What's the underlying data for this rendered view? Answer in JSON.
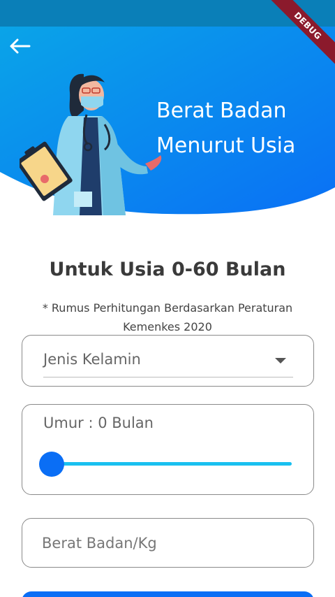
{
  "debug_badge": "DEBUG",
  "header": {
    "title_line1": "Berat Badan",
    "title_line2": "Menurut Usia",
    "back_icon": "arrow-back-icon"
  },
  "main": {
    "title": "Untuk Usia 0-60 Bulan",
    "subtitle": "* Rumus Perhitungan Berdasarkan Peraturan Kemenkes 2020"
  },
  "form": {
    "gender_dropdown": {
      "placeholder": "Jenis Kelamin",
      "icon": "dropdown-arrow-icon"
    },
    "age": {
      "label": "Umur : 0 Bulan",
      "slider_value": 0,
      "slider_min": 0,
      "slider_max": 60
    },
    "weight_input": {
      "placeholder": "Berat Badan/Kg",
      "value": ""
    }
  },
  "colors": {
    "header_gradient_start": "#0aa0e6",
    "header_gradient_end": "#0a6ef5",
    "status_bar": "#0a7fb8",
    "accent": "#0a6ef5",
    "slider_track": "#19c0f0",
    "debug_ribbon": "#8b1a2c"
  }
}
